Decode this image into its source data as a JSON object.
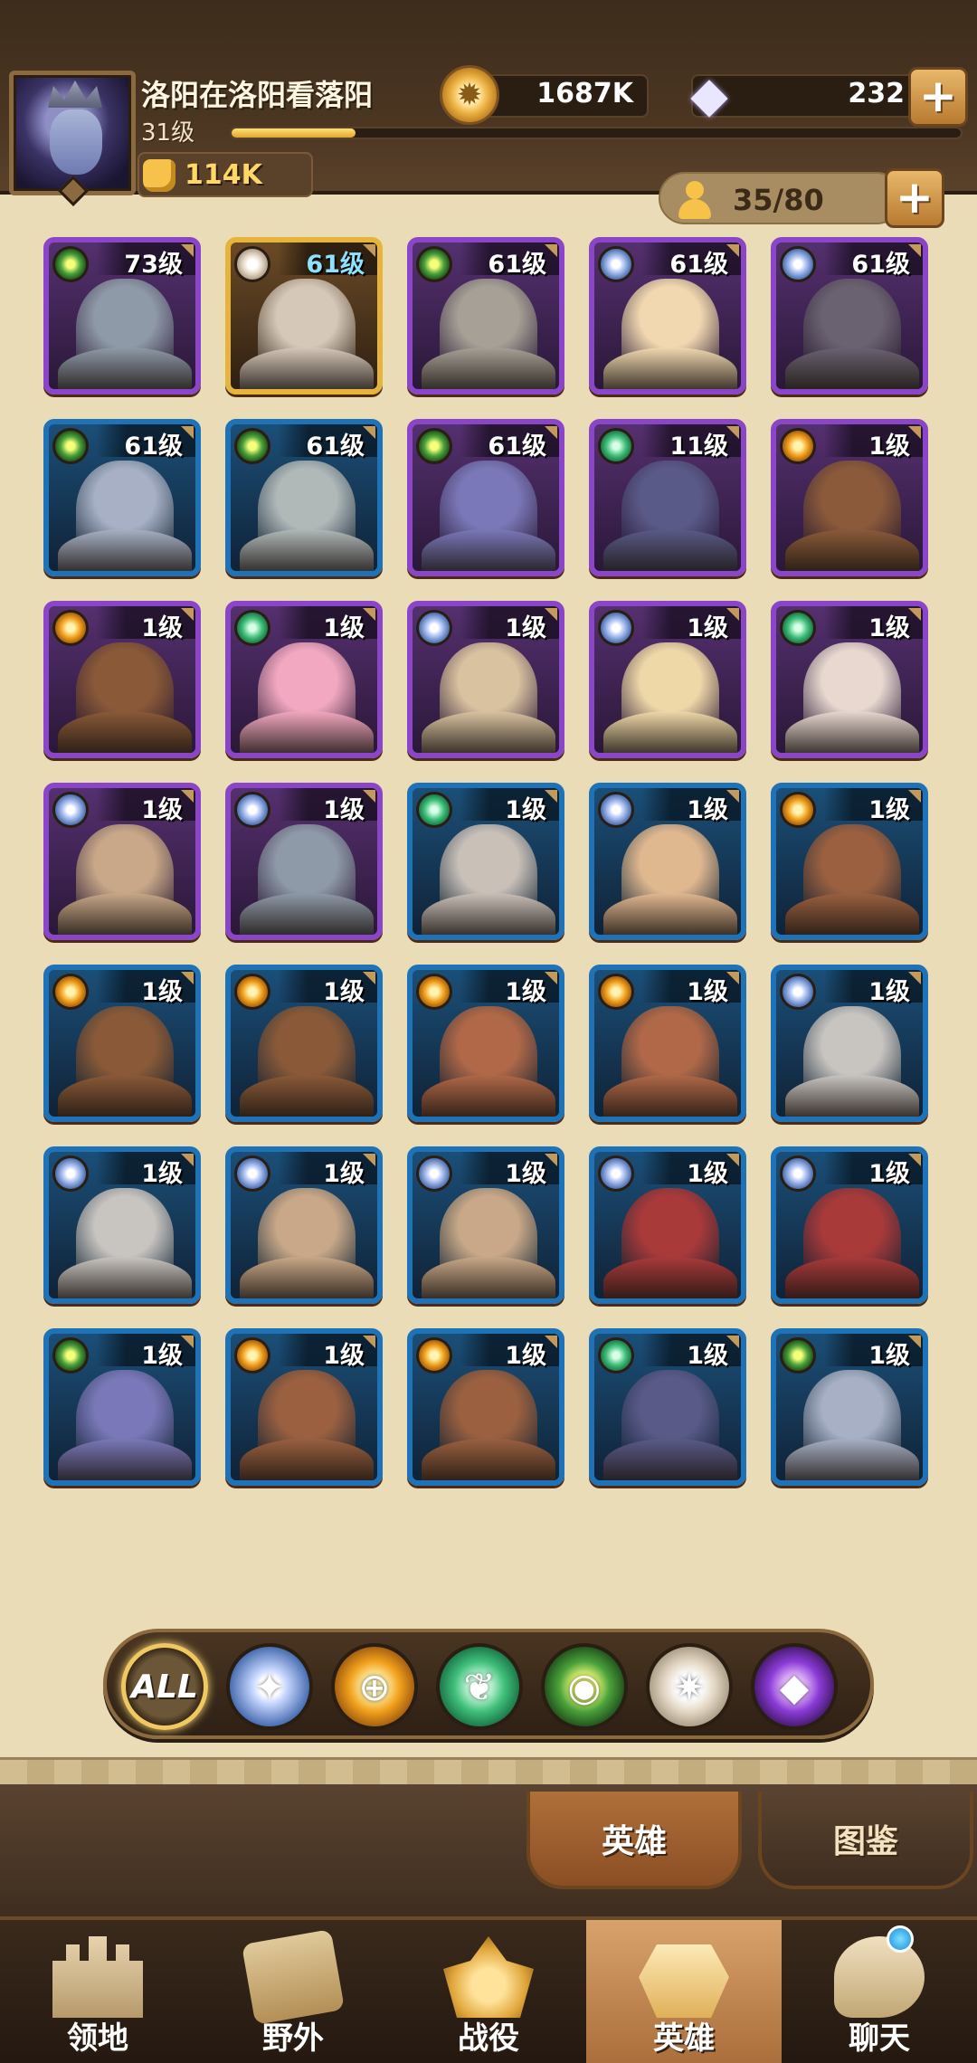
{
  "player": {
    "name": "洛阳在洛阳看落阳",
    "level": "31级",
    "xp_progress": 0.17,
    "power": "114K"
  },
  "currency": {
    "gold": "1687K",
    "gems": "232"
  },
  "hero_slots": "35/80",
  "heroes": [
    {
      "level": "73级",
      "faction": "fac-eye",
      "frame": "purple",
      "portrait": "#8f9aa8"
    },
    {
      "level": "61级",
      "faction": "fac-star",
      "frame": "gold",
      "portrait": "#d6c8b8"
    },
    {
      "level": "61级",
      "faction": "fac-eye",
      "frame": "purple",
      "portrait": "#a6a096"
    },
    {
      "level": "61级",
      "faction": "fac-light",
      "frame": "purple",
      "portrait": "#f1d8b0"
    },
    {
      "level": "61级",
      "faction": "fac-light",
      "frame": "purple",
      "portrait": "#6a6270"
    },
    {
      "level": "61级",
      "faction": "fac-eye",
      "frame": "blue",
      "portrait": "#a7b0c4"
    },
    {
      "level": "61级",
      "faction": "fac-eye",
      "frame": "blue",
      "portrait": "#b0b8b8"
    },
    {
      "level": "61级",
      "faction": "fac-eye",
      "frame": "purple",
      "portrait": "#7a78b8"
    },
    {
      "level": "11级",
      "faction": "fac-nature",
      "frame": "purple",
      "portrait": "#5a5a88"
    },
    {
      "level": "1级",
      "faction": "fac-ember",
      "frame": "purple",
      "portrait": "#8a5a3a"
    },
    {
      "level": "1级",
      "faction": "fac-ember",
      "frame": "purple",
      "portrait": "#8a5a38"
    },
    {
      "level": "1级",
      "faction": "fac-nature",
      "frame": "purple",
      "portrait": "#f2a8c0"
    },
    {
      "level": "1级",
      "faction": "fac-light",
      "frame": "purple",
      "portrait": "#d9c2a0"
    },
    {
      "level": "1级",
      "faction": "fac-light",
      "frame": "purple",
      "portrait": "#efd8a8"
    },
    {
      "level": "1级",
      "faction": "fac-nature",
      "frame": "purple",
      "portrait": "#e8d8d0"
    },
    {
      "level": "1级",
      "faction": "fac-light",
      "frame": "purple",
      "portrait": "#c8a888"
    },
    {
      "level": "1级",
      "faction": "fac-light",
      "frame": "purple",
      "portrait": "#8f9aa8"
    },
    {
      "level": "1级",
      "faction": "fac-nature",
      "frame": "blue",
      "portrait": "#c9c0b8"
    },
    {
      "level": "1级",
      "faction": "fac-light",
      "frame": "blue",
      "portrait": "#e0b890"
    },
    {
      "level": "1级",
      "faction": "fac-ember",
      "frame": "blue",
      "portrait": "#9a6040"
    },
    {
      "level": "1级",
      "faction": "fac-ember",
      "frame": "blue",
      "portrait": "#8a5a38"
    },
    {
      "level": "1级",
      "faction": "fac-ember",
      "frame": "blue",
      "portrait": "#8a5a38"
    },
    {
      "level": "1级",
      "faction": "fac-ember",
      "frame": "blue",
      "portrait": "#b06848"
    },
    {
      "level": "1级",
      "faction": "fac-ember",
      "frame": "blue",
      "portrait": "#b06848"
    },
    {
      "level": "1级",
      "faction": "fac-light",
      "frame": "blue",
      "portrait": "#c8c4c0"
    },
    {
      "level": "1级",
      "faction": "fac-light",
      "frame": "blue",
      "portrait": "#c8c4c0"
    },
    {
      "level": "1级",
      "faction": "fac-light",
      "frame": "blue",
      "portrait": "#c8a888"
    },
    {
      "level": "1级",
      "faction": "fac-light",
      "frame": "blue",
      "portrait": "#c8a888"
    },
    {
      "level": "1级",
      "faction": "fac-light",
      "frame": "blue",
      "portrait": "#a83a3a"
    },
    {
      "level": "1级",
      "faction": "fac-light",
      "frame": "blue",
      "portrait": "#a83a3a"
    },
    {
      "level": "1级",
      "faction": "fac-eye",
      "frame": "blue",
      "portrait": "#7a78b8"
    },
    {
      "level": "1级",
      "faction": "fac-ember",
      "frame": "blue",
      "portrait": "#9a6040"
    },
    {
      "level": "1级",
      "faction": "fac-ember",
      "frame": "blue",
      "portrait": "#9a6040"
    },
    {
      "level": "1级",
      "faction": "fac-nature",
      "frame": "blue",
      "portrait": "#5a5a88"
    },
    {
      "level": "1级",
      "faction": "fac-eye",
      "frame": "blue",
      "portrait": "#a7b0c4"
    }
  ],
  "faction_filters": [
    {
      "name": "all",
      "label": "ALL",
      "class": "all"
    },
    {
      "name": "lightbearer",
      "glyph": "✦",
      "class": "fac-light"
    },
    {
      "name": "mauler",
      "glyph": "⊕",
      "class": "fac-ember"
    },
    {
      "name": "wilder",
      "glyph": "❦",
      "class": "fac-nature"
    },
    {
      "name": "graveborn",
      "glyph": "◉",
      "class": "fac-eye"
    },
    {
      "name": "celestial",
      "glyph": "✷",
      "class": "fac-star"
    },
    {
      "name": "hypogean",
      "glyph": "◆",
      "class": "fac-void"
    }
  ],
  "subtabs": {
    "heroes": "英雄",
    "codex": "图鉴"
  },
  "nav": [
    {
      "label": "领地",
      "icon": "castle"
    },
    {
      "label": "野外",
      "icon": "scroll"
    },
    {
      "label": "战役",
      "icon": "helmet-gold"
    },
    {
      "label": "英雄",
      "icon": "helmet-hero",
      "active": true
    },
    {
      "label": "聊天",
      "icon": "bubble"
    }
  ]
}
